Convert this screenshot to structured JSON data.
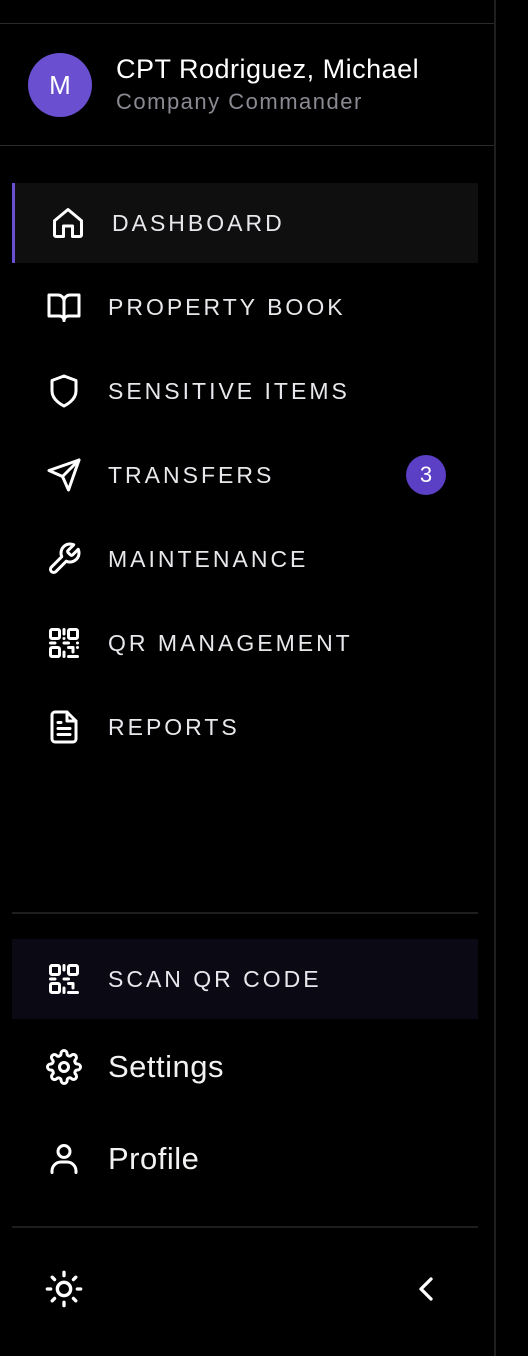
{
  "user": {
    "initial": "M",
    "name": "CPT Rodriguez, Michael",
    "role": "Company Commander"
  },
  "nav": {
    "items": [
      {
        "label": "DASHBOARD",
        "icon": "home-icon",
        "active": true
      },
      {
        "label": "PROPERTY BOOK",
        "icon": "book-open-icon"
      },
      {
        "label": "SENSITIVE ITEMS",
        "icon": "shield-icon"
      },
      {
        "label": "TRANSFERS",
        "icon": "send-icon",
        "badge": "3"
      },
      {
        "label": "MAINTENANCE",
        "icon": "wrench-icon"
      },
      {
        "label": "QR MANAGEMENT",
        "icon": "qr-code-icon"
      },
      {
        "label": "REPORTS",
        "icon": "file-text-icon"
      }
    ]
  },
  "actions": {
    "scan_label": "SCAN QR CODE",
    "settings_label": "Settings",
    "profile_label": "Profile"
  },
  "footer": {
    "theme_icon": "sun-icon",
    "collapse_icon": "chevron-left-icon"
  },
  "colors": {
    "accent": "#6a4fd0",
    "badge": "#5b3fc4",
    "background": "#000000"
  }
}
